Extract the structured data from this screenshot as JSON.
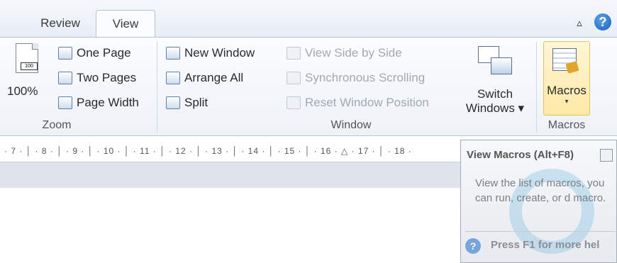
{
  "tabs": {
    "review": "Review",
    "view": "View"
  },
  "help": "?",
  "collapse_glyph": "▵",
  "zoom": {
    "percent": "100%",
    "one_page": "One Page",
    "two_pages": "Two Pages",
    "page_width": "Page Width",
    "group_label": "Zoom"
  },
  "window": {
    "new_window": "New Window",
    "arrange_all": "Arrange All",
    "split": "Split",
    "view_side_by_side": "View Side by Side",
    "synchronous_scrolling": "Synchronous Scrolling",
    "reset_window_position": "Reset Window Position",
    "switch_windows_line1": "Switch",
    "switch_windows_line2": "Windows ▾",
    "group_label": "Window"
  },
  "macros": {
    "button_label": "Macros",
    "arrow": "▾",
    "group_label": "Macros"
  },
  "ruler": {
    "ticks": [
      "· 7 · │ · 8 · │ · 9 · │ · 10 · │ · 11 · │ · 12 · │ · 13 · │ · 14 · │ · 15 · │ · 16 · △ · 17 · │ · 18 ·"
    ]
  },
  "tooltip": {
    "title": "View Macros (Alt+F8)",
    "body": "View the list of macros, you can run, create, or d macro.",
    "footer": "Press F1 for more hel"
  },
  "colors": {
    "accent": "#1a5fb4",
    "macro_highlight": "#fde9a6"
  }
}
